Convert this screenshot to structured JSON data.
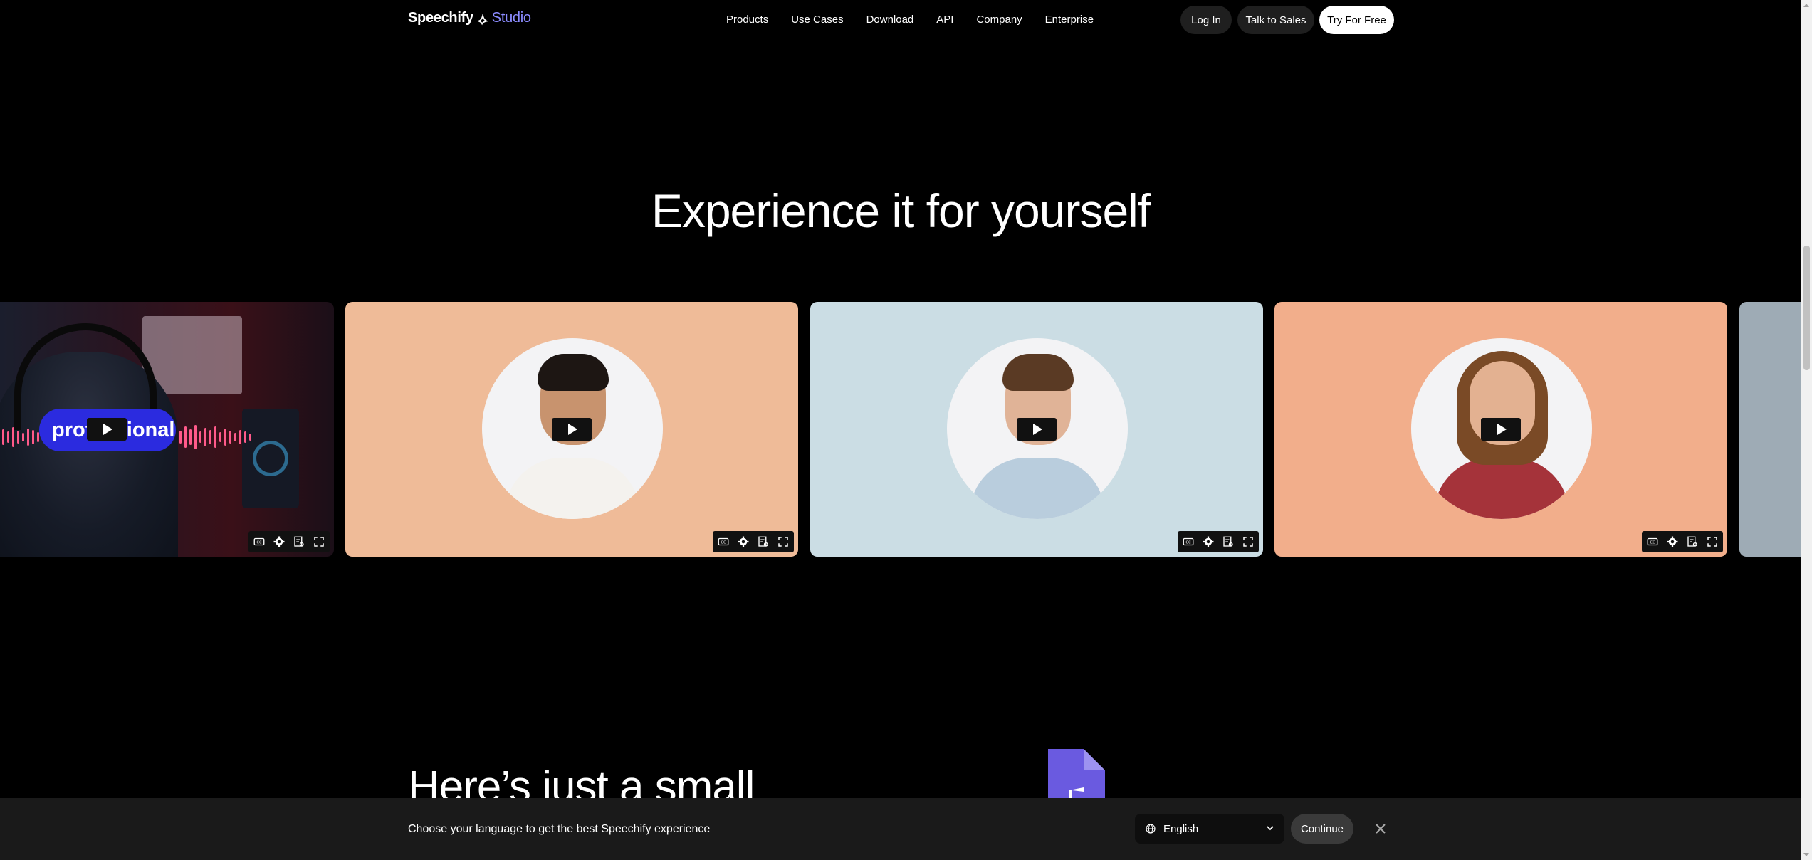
{
  "nav": {
    "logo_main": "Speechify",
    "logo_sub": "Studio",
    "menu": [
      "Products",
      "Use Cases",
      "Download",
      "API",
      "Company",
      "Enterprise"
    ],
    "login": "Log In",
    "sales": "Talk to Sales",
    "try": "Try For Free"
  },
  "hero": {
    "title": "Experience it for yourself"
  },
  "carousel": {
    "cards": [
      {
        "overlay_text": "professional",
        "bg": "#2a1420"
      },
      {
        "bg": "#efbb98",
        "skin": "#c8936e",
        "hair": "#1d1613",
        "shirt": "#f4f2ee"
      },
      {
        "bg": "#cbdde4",
        "skin": "#e0b397",
        "hair": "#5a3a24",
        "shirt": "#b9cddd"
      },
      {
        "bg": "#f2ae8b",
        "skin": "#e3b191",
        "hair": "#7a4a26",
        "shirt": "#a5333a"
      },
      {
        "bg": "#9eabb5"
      }
    ],
    "control_icons": [
      "captions-icon",
      "gear-icon",
      "transcript-icon",
      "fullscreen-icon"
    ]
  },
  "section2": {
    "title": "Here’s just a small"
  },
  "language_bar": {
    "prompt": "Choose your language to get the best Speechify experience",
    "selected": "English",
    "continue": "Continue"
  },
  "colors": {
    "accent": "#8b8bff",
    "pill": "#2b2bdf",
    "doc": "#6a5ae0"
  }
}
